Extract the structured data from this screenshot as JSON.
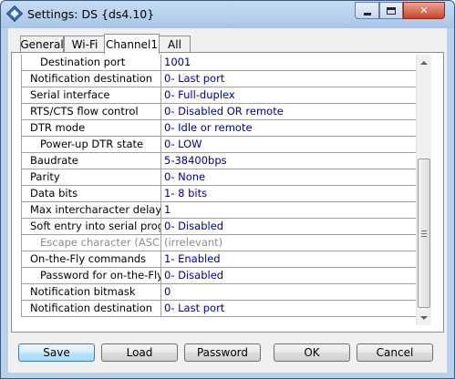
{
  "window": {
    "title": "Settings: DS {ds4.10}"
  },
  "tabs": [
    {
      "label": "General"
    },
    {
      "label": "Wi-Fi"
    },
    {
      "label": "Channel1",
      "active": true
    },
    {
      "label": "All"
    }
  ],
  "rows": [
    {
      "name": "Destination port",
      "value": "1001",
      "indent": true,
      "disabled": false
    },
    {
      "name": "Notification destination",
      "value": "0- Last port",
      "indent": false,
      "disabled": false
    },
    {
      "name": "Serial interface",
      "value": "0- Full-duplex",
      "indent": false,
      "disabled": false
    },
    {
      "name": "RTS/CTS flow control",
      "value": "0- Disabled OR remote",
      "indent": false,
      "disabled": false
    },
    {
      "name": "DTR mode",
      "value": "0- Idle or remote",
      "indent": false,
      "disabled": false
    },
    {
      "name": "Power-up DTR state",
      "value": "0- LOW",
      "indent": true,
      "disabled": false
    },
    {
      "name": "Baudrate",
      "value": "5-38400bps",
      "indent": false,
      "disabled": false
    },
    {
      "name": "Parity",
      "value": "0- None",
      "indent": false,
      "disabled": false
    },
    {
      "name": "Data bits",
      "value": "1- 8 bits",
      "indent": false,
      "disabled": false
    },
    {
      "name": "Max intercharacter delay",
      "value": "1",
      "indent": false,
      "disabled": false
    },
    {
      "name": "Soft entry into serial progra",
      "value": "0- Disabled",
      "indent": false,
      "disabled": false
    },
    {
      "name": "Escape character (ASCII",
      "value": "(irrelevant)",
      "indent": true,
      "disabled": true
    },
    {
      "name": "On-the-Fly commands",
      "value": "1- Enabled",
      "indent": false,
      "disabled": false
    },
    {
      "name": "Password for on-the-Fly",
      "value": "0- Disabled",
      "indent": true,
      "disabled": false
    },
    {
      "name": "Notification bitmask",
      "value": "0",
      "indent": false,
      "disabled": false
    },
    {
      "name": "Notification destination",
      "value": "0- Last port",
      "indent": false,
      "disabled": false
    }
  ],
  "buttons": {
    "save": "Save",
    "load": "Load",
    "password": "Password",
    "ok": "OK",
    "cancel": "Cancel"
  },
  "icons": {
    "app": "ds-diamond-icon",
    "minimize": "minimize-icon",
    "maximize": "maximize-icon",
    "close": "close-icon"
  },
  "colors": {
    "value_text": "#000080",
    "disabled_text": "#8c8c8c",
    "titlebar": "#b9d1ea",
    "close_button": "#c8452d"
  }
}
